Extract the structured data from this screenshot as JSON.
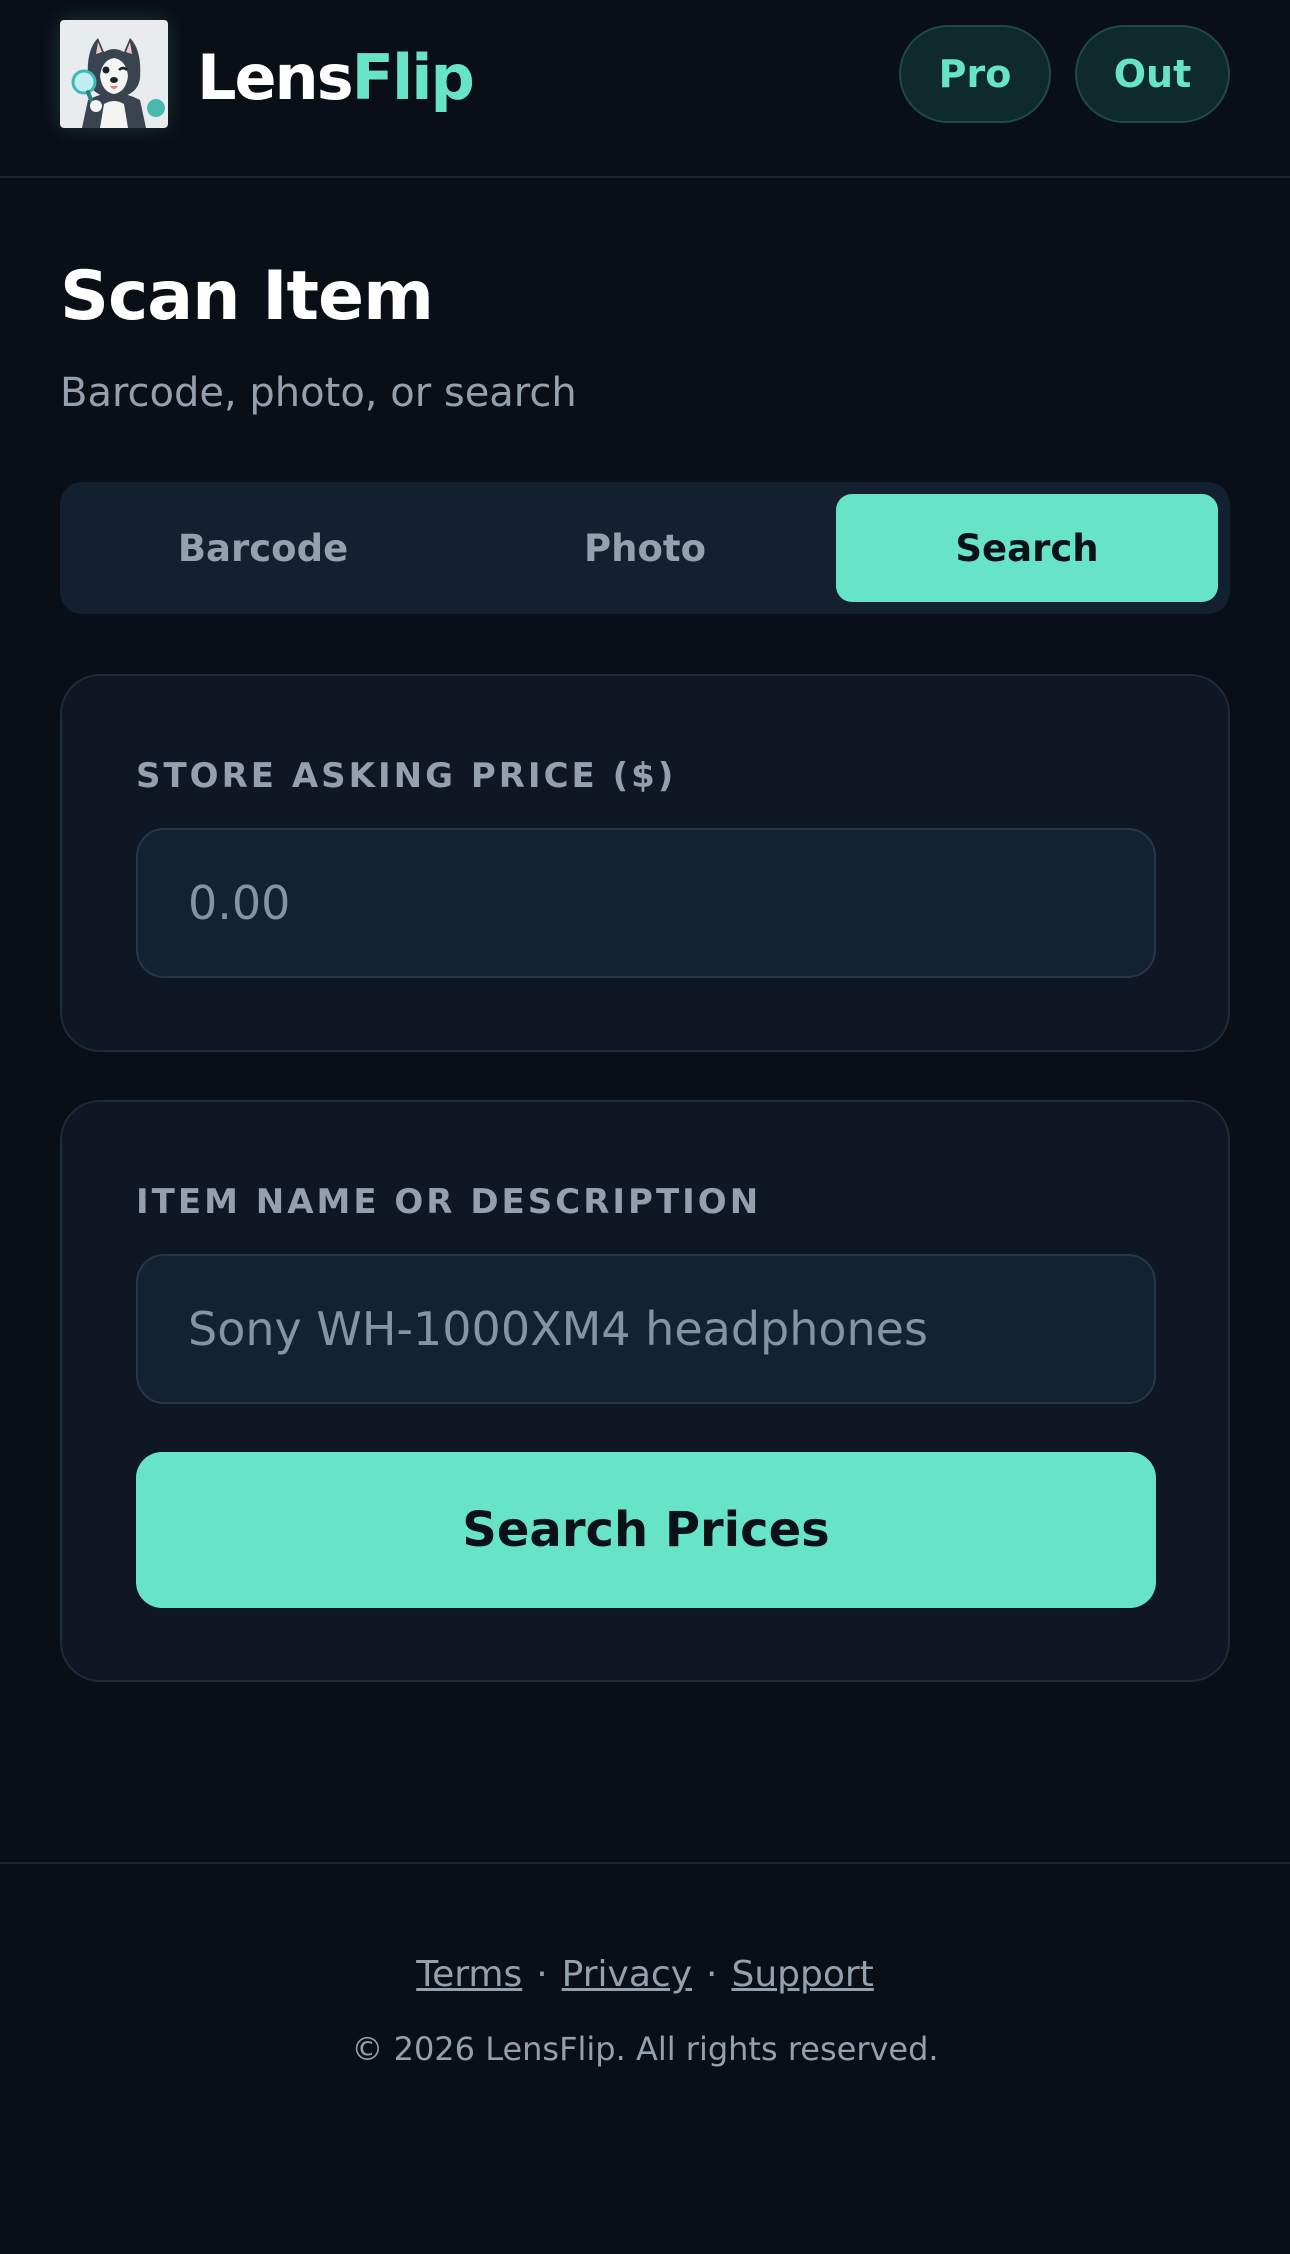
{
  "header": {
    "brand_part1": "Lens",
    "brand_part2": "Flip",
    "logo_icon": "husky-magnifier-logo",
    "pro_label": "Pro",
    "out_label": "Out"
  },
  "main": {
    "title": "Scan Item",
    "subtitle": "Barcode, photo, or search",
    "tabs": [
      {
        "label": "Barcode",
        "active": false
      },
      {
        "label": "Photo",
        "active": false
      },
      {
        "label": "Search",
        "active": true
      }
    ],
    "price_field": {
      "label": "Store Asking Price ($)",
      "placeholder": "0.00",
      "value": ""
    },
    "item_field": {
      "label": "Item Name or Description",
      "placeholder": "Sony WH-1000XM4 headphones",
      "value": ""
    },
    "search_button_label": "Search Prices"
  },
  "footer": {
    "links": [
      "Terms",
      "Privacy",
      "Support"
    ],
    "separator": "·",
    "copyright": "© 2026 LensFlip. All rights reserved."
  },
  "colors": {
    "background": "#0a0e16",
    "accent": "#67e3c8",
    "card": "#0f1624",
    "muted_text": "#94a0ae"
  }
}
